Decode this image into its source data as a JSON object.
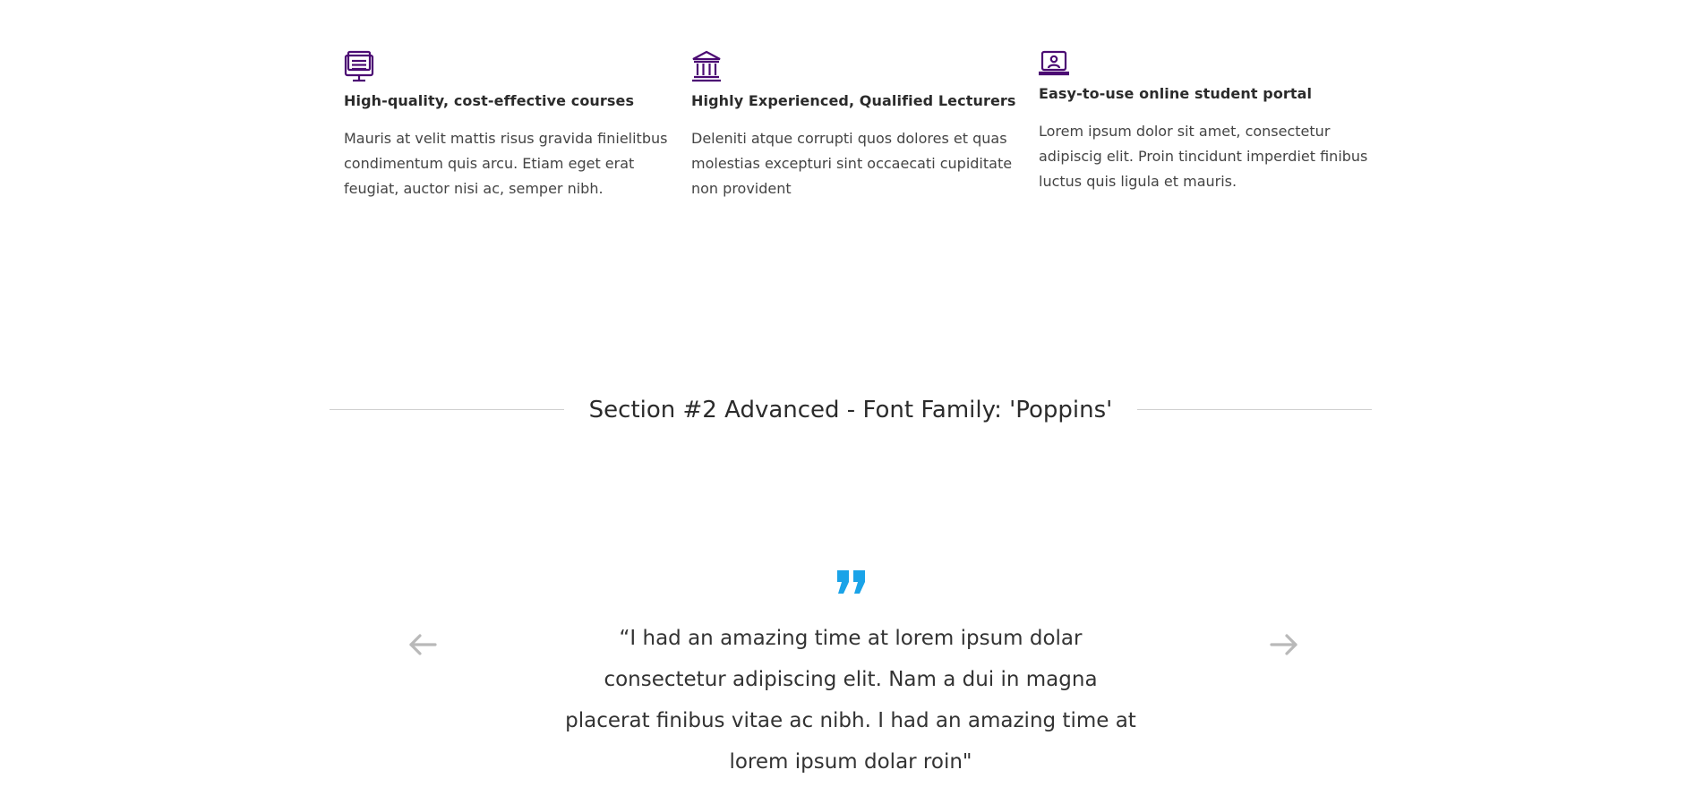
{
  "features": [
    {
      "icon": "monitor-document-icon",
      "title": "High-quality, cost-effective courses",
      "body": "Mauris at velit mattis risus gravida finielitbus condimentum quis arcu. Etiam eget erat feugiat, auctor nisi ac, semper nibh."
    },
    {
      "icon": "institution-building-icon",
      "title": "Highly Experienced, Qualified Lecturers",
      "body": "Deleniti atque corrupti quos dolores et quas molestias excepturi sint occaecati cupiditate non provident"
    },
    {
      "icon": "laptop-user-icon",
      "title": "Easy-to-use online student portal",
      "body": "Lorem ipsum dolor sit amet, consectetur adipiscig elit. Proin tincidunt imperdiet finibus luctus quis ligula et mauris."
    }
  ],
  "section": {
    "title": "Section #2 Advanced - Font Family: 'Poppins'"
  },
  "testimonial": {
    "quote_icon": "quote-icon",
    "text": "“I had an amazing time at lorem ipsum dolar consectetur adipiscing elit. Nam a dui in magna placerat finibus vitae ac nibh. I had an amazing time at lorem ipsum dolar roin\"",
    "prev_icon": "arrow-left-icon",
    "next_icon": "arrow-right-icon"
  },
  "colors": {
    "icon_accent": "#4b0a73",
    "quote_accent": "#1aa3e8",
    "arrow": "#b9b9b9",
    "divider": "#cfcfcf",
    "text": "#2b2b2b"
  }
}
